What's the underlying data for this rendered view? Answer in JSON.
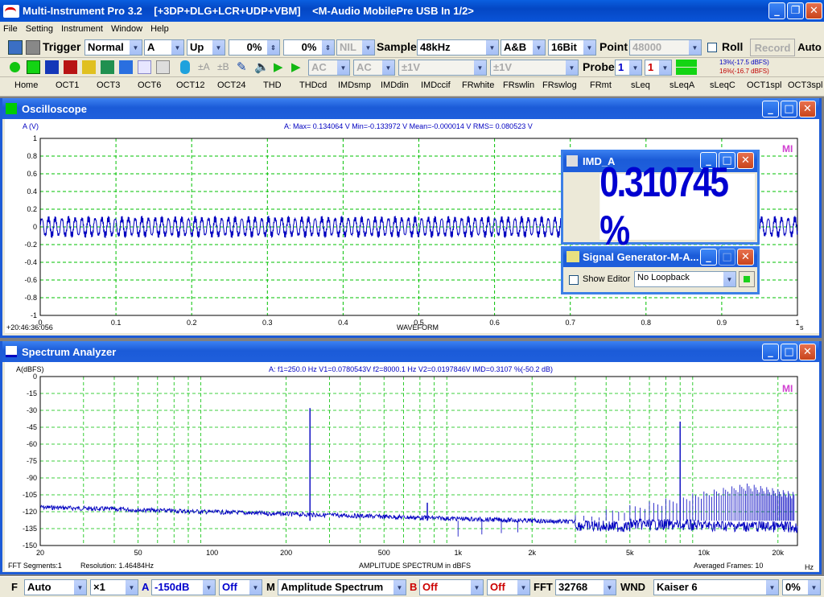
{
  "app": {
    "title": "Multi-Instrument Pro 3.2    [+3DP+DLG+LCR+UDP+VBM]    <M-Audio MobilePre USB In 1/2>"
  },
  "menu": [
    "File",
    "Setting",
    "Instrument",
    "Window",
    "Help"
  ],
  "toolbar1": {
    "trigger_label": "Trigger",
    "trigger_mode": "Normal",
    "trigger_channel": "A",
    "trigger_edge": "Up",
    "trigger_level": "0%",
    "trigger_delay": "0%",
    "nil": "NIL",
    "sample_label": "Sample",
    "sample_rate": "48kHz",
    "channels": "A&B",
    "bits": "16Bit",
    "point_label": "Point",
    "point_value": "48000",
    "roll_label": "Roll",
    "record_label": "Record",
    "auto_label": "Auto"
  },
  "toolbar2": {
    "coupling_a": "AC",
    "coupling_b": "AC",
    "range_a": "±1V",
    "range_b": "±1V",
    "probe_label": "Probe",
    "probe_a": "1",
    "probe_b": "1",
    "level_a": "13%(-17.5 dBFS)",
    "level_b": "16%(-16.7 dBFS)"
  },
  "tabs": [
    "Home",
    "OCT1",
    "OCT3",
    "OCT6",
    "OCT12",
    "OCT24",
    "THD",
    "THDcd",
    "IMDsmp",
    "IMDdin",
    "IMDccif",
    "FRwhite",
    "FRswlin",
    "FRswlog",
    "FRmt",
    "sLeq",
    "sLeqA",
    "sLeqC",
    "OCT1spl",
    "OCT3spl"
  ],
  "oscilloscope": {
    "title": "Oscilloscope",
    "ylabel": "A (V)",
    "stats": "A: Max= 0.134064 V  Min=-0.133972 V  Mean=-0.000014 V  RMS= 0.080523 V",
    "xlabel": "WAVEFORM",
    "xunit": "s",
    "timestamp": "+20:46:36:056",
    "watermark": "MI"
  },
  "imd_window": {
    "title": "IMD_A",
    "value": "0.310745 %"
  },
  "siggen_window": {
    "title": "Signal Generator-M-A...",
    "show_editor": "Show Editor",
    "loopback": "No Loopback"
  },
  "spectrum": {
    "title": "Spectrum Analyzer",
    "ylabel": "A(dBFS)",
    "stats": "A: f1=250.0 Hz  V1=0.0780543V  f2=8000.1 Hz  V2=0.0197846V  IMD=0.3107 %(-50.2 dB)",
    "xlabel": "AMPLITUDE SPECTRUM in dBFS",
    "xunit": "Hz",
    "fft_segments": "FFT Segments:1",
    "resolution": "Resolution: 1.46484Hz",
    "averaged": "Averaged Frames: 10",
    "watermark": "MI"
  },
  "statusbar": {
    "f_label": "F",
    "auto": "Auto",
    "mult": "×1",
    "a_label": "A",
    "db": "-150dB",
    "off1": "Off",
    "m_label": "M",
    "mode": "Amplitude Spectrum",
    "b_label": "B",
    "off2": "Off",
    "off3": "Off",
    "fft_label": "FFT",
    "fft_size": "32768",
    "wnd_label": "WND",
    "window": "Kaiser 6",
    "percent": "0%"
  },
  "chart_data": [
    {
      "type": "line",
      "title": "",
      "xlabel": "WAVEFORM",
      "ylabel": "A (V)",
      "xlim": [
        0,
        1
      ],
      "ylim": [
        -1,
        1
      ],
      "x_ticks": [
        "0",
        "0.1",
        "0.2",
        "0.3",
        "0.4",
        "0.5",
        "0.6",
        "0.7",
        "0.8",
        "0.9",
        "1"
      ],
      "y_ticks": [
        "1",
        "0.8",
        "0.6",
        "0.4",
        "0.2",
        "0",
        "-0.2",
        "-0.4",
        "-0.6",
        "-0.8",
        "-1"
      ],
      "grid": true,
      "series": [
        {
          "name": "A",
          "amplitude": 0.134,
          "f1": 250,
          "f2": 8000
        }
      ]
    },
    {
      "type": "line",
      "title": "",
      "xlabel": "AMPLITUDE SPECTRUM in dBFS",
      "ylabel": "A(dBFS)",
      "xscale": "log",
      "xlim": [
        20,
        24000
      ],
      "ylim": [
        -150,
        0
      ],
      "x_ticks": [
        "20",
        "50",
        "100",
        "200",
        "500",
        "1k",
        "2k",
        "5k",
        "10k",
        "20k"
      ],
      "y_ticks": [
        "0",
        "-15",
        "-30",
        "-45",
        "-60",
        "-75",
        "-90",
        "-105",
        "-120",
        "-135",
        "-150"
      ],
      "grid": true,
      "peaks": [
        {
          "x": 250,
          "y": -28
        },
        {
          "x": 500,
          "y": -128
        },
        {
          "x": 750,
          "y": -112
        },
        {
          "x": 8000,
          "y": -40
        }
      ],
      "noise_floor": -128
    }
  ]
}
